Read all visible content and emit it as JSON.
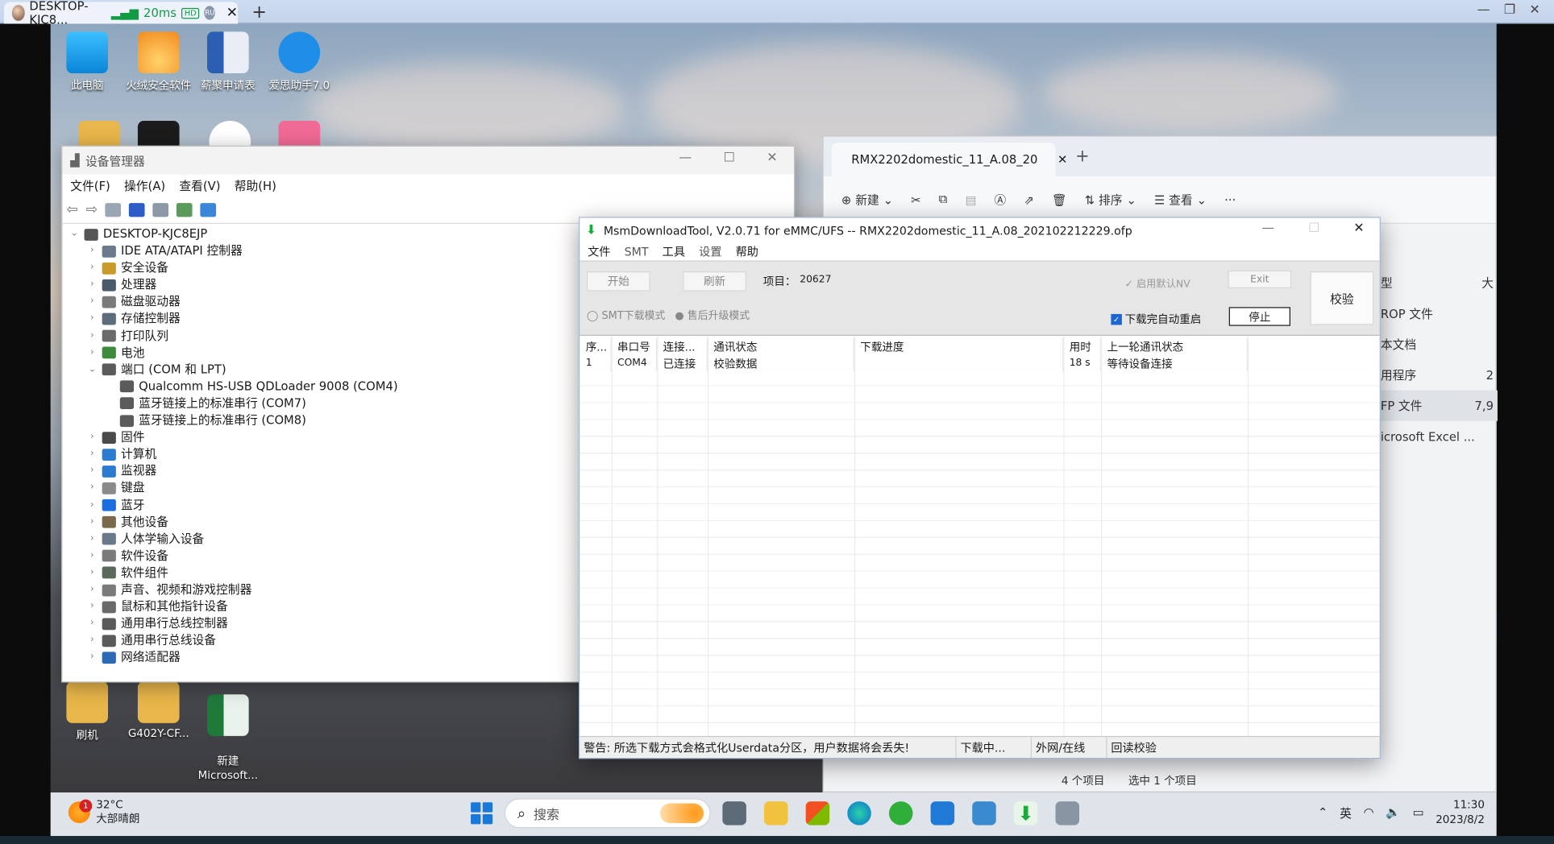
{
  "host": {
    "tab_title": "DESKTOP-KJC8...",
    "latency": "20ms",
    "hd": "HD",
    "ru": "RU",
    "close": "✕",
    "new_tab": "+",
    "ctrl_min": "—",
    "ctrl_restore": "❐",
    "ctrl_close": "✕"
  },
  "desktop_icons": [
    {
      "label": "此电脑",
      "color": "#1aa1e8"
    },
    {
      "label": "火绒安全软件",
      "color": "#f28a1e"
    },
    {
      "label": "薪聚申请表",
      "color": "#2b5fb4"
    },
    {
      "label": "爱思助手7.0",
      "color": "#1e8ee8"
    },
    {
      "label": "刷机",
      "color": "#e8b64a"
    },
    {
      "label": "G402Y-CF...",
      "color": "#e8b64a"
    },
    {
      "label": "新建\nMicrosoft...",
      "color": "#1f7a3a"
    }
  ],
  "device_manager": {
    "title": "设备管理器",
    "menu": [
      "文件(F)",
      "操作(A)",
      "查看(V)",
      "帮助(H)"
    ],
    "tree": [
      {
        "label": "DESKTOP-KJC8EJP",
        "level": 0,
        "chev": "⌄",
        "icon_color": "#555"
      },
      {
        "label": "IDE ATA/ATAPI 控制器",
        "level": 1,
        "chev": "›",
        "icon_color": "#6b7a8c"
      },
      {
        "label": "安全设备",
        "level": 1,
        "chev": "›",
        "icon_color": "#c89a2a"
      },
      {
        "label": "处理器",
        "level": 1,
        "chev": "›",
        "icon_color": "#4a5a6a"
      },
      {
        "label": "磁盘驱动器",
        "level": 1,
        "chev": "›",
        "icon_color": "#7a7a7a"
      },
      {
        "label": "存储控制器",
        "level": 1,
        "chev": "›",
        "icon_color": "#5c6c7c"
      },
      {
        "label": "打印队列",
        "level": 1,
        "chev": "›",
        "icon_color": "#6a6a6a"
      },
      {
        "label": "电池",
        "level": 1,
        "chev": "›",
        "icon_color": "#3d8a3d"
      },
      {
        "label": "端口 (COM 和 LPT)",
        "level": 1,
        "chev": "⌄",
        "icon_color": "#5a5a5a"
      },
      {
        "label": "Qualcomm HS-USB QDLoader 9008 (COM4)",
        "level": 2,
        "chev": "",
        "icon_color": "#5a5a5a"
      },
      {
        "label": "蓝牙链接上的标准串行 (COM7)",
        "level": 2,
        "chev": "",
        "icon_color": "#5a5a5a"
      },
      {
        "label": "蓝牙链接上的标准串行 (COM8)",
        "level": 2,
        "chev": "",
        "icon_color": "#5a5a5a"
      },
      {
        "label": "固件",
        "level": 1,
        "chev": "›",
        "icon_color": "#4a4a4a"
      },
      {
        "label": "计算机",
        "level": 1,
        "chev": "›",
        "icon_color": "#2b7bd1"
      },
      {
        "label": "监视器",
        "level": 1,
        "chev": "›",
        "icon_color": "#2b7bd1"
      },
      {
        "label": "键盘",
        "level": 1,
        "chev": "›",
        "icon_color": "#8a8a8a"
      },
      {
        "label": "蓝牙",
        "level": 1,
        "chev": "›",
        "icon_color": "#1a6ee0"
      },
      {
        "label": "其他设备",
        "level": 1,
        "chev": "›",
        "icon_color": "#7a6a4a"
      },
      {
        "label": "人体学输入设备",
        "level": 1,
        "chev": "›",
        "icon_color": "#6a7a8a"
      },
      {
        "label": "软件设备",
        "level": 1,
        "chev": "›",
        "icon_color": "#7a7a7a"
      },
      {
        "label": "软件组件",
        "level": 1,
        "chev": "›",
        "icon_color": "#5a6a5a"
      },
      {
        "label": "声音、视频和游戏控制器",
        "level": 1,
        "chev": "›",
        "icon_color": "#7a7a7a"
      },
      {
        "label": "鼠标和其他指针设备",
        "level": 1,
        "chev": "›",
        "icon_color": "#6a6a6a"
      },
      {
        "label": "通用串行总线控制器",
        "level": 1,
        "chev": "›",
        "icon_color": "#5a5a5a"
      },
      {
        "label": "通用串行总线设备",
        "level": 1,
        "chev": "›",
        "icon_color": "#5a5a5a"
      },
      {
        "label": "网络适配器",
        "level": 1,
        "chev": "›",
        "icon_color": "#2b6bb5"
      }
    ]
  },
  "explorer": {
    "tab_title": "RMX2202domestic_11_A.08_20",
    "tab_close": "✕",
    "new_tab": "+",
    "new_label": "新建",
    "sort_label": "排序",
    "view_label": "查看",
    "more": "···",
    "col_header": "型",
    "col_header2": "大",
    "rows": [
      {
        "type": "ROP 文件",
        "size": ""
      },
      {
        "type": "本文档",
        "size": ""
      },
      {
        "type": "用程序",
        "size": "2"
      },
      {
        "type": "FP 文件",
        "size": "7,9"
      },
      {
        "type": "icrosoft Excel ...",
        "size": ""
      }
    ],
    "status_items": "4 个项目",
    "status_selected": "选中 1 个项目"
  },
  "msm": {
    "title": "MsmDownloadTool, V2.0.71 for eMMC/UFS -- RMX2202domestic_11_A.08_202102212229.ofp",
    "menu": [
      "文件",
      "SMT",
      "工具",
      "设置",
      "帮助"
    ],
    "btn_start": "开始",
    "btn_refresh": "刷新",
    "project_label": "项目：",
    "project_value": "20627",
    "enable_default_nv": "启用默认NV",
    "btn_exit": "Exit",
    "btn_verify": "校验",
    "smt_mode": "SMT下载模式",
    "after_sale_mode": "售后升级模式",
    "auto_reboot": "下载完自动重启",
    "auto_reboot_checked": true,
    "btn_stop": "停止",
    "columns": [
      "序...",
      "串口号",
      "连接...",
      "通讯状态",
      "下载进度",
      "用时",
      "上一轮通讯状态"
    ],
    "rows": [
      [
        "1",
        "COM4",
        "已连接",
        "校验数据",
        "",
        "18 s",
        "等待设备连接"
      ]
    ],
    "status_warning": "警告: 所选下载方式会格式化Userdata分区，用户数据将会丢失!",
    "status_state": "下载中...",
    "status_network": "外网/在线",
    "status_readback": "回读校验"
  },
  "taskbar": {
    "badge": "1",
    "temp": "32°C",
    "weather": "大部晴朗",
    "search": "搜索",
    "ime": "英",
    "time": "11:30",
    "date": "2023/8/2"
  }
}
